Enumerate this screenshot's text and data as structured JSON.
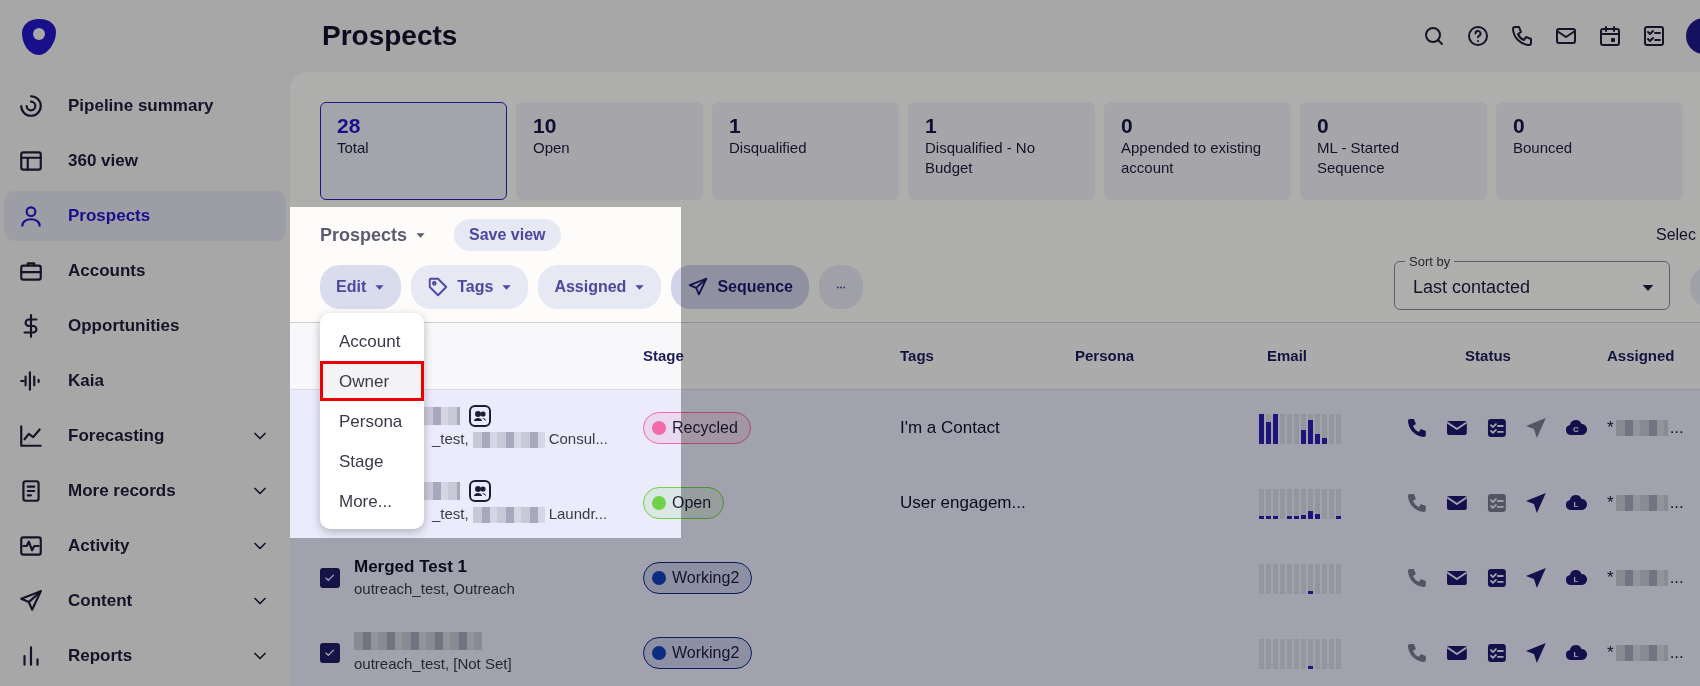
{
  "sidebar": {
    "items": [
      {
        "label": "Pipeline summary",
        "selected": false,
        "expandable": false
      },
      {
        "label": "360 view",
        "selected": false,
        "expandable": false
      },
      {
        "label": "Prospects",
        "selected": true,
        "expandable": false
      },
      {
        "label": "Accounts",
        "selected": false,
        "expandable": false
      },
      {
        "label": "Opportunities",
        "selected": false,
        "expandable": false
      },
      {
        "label": "Kaia",
        "selected": false,
        "expandable": false
      },
      {
        "label": "Forecasting",
        "selected": false,
        "expandable": true
      },
      {
        "label": "More records",
        "selected": false,
        "expandable": true
      },
      {
        "label": "Activity",
        "selected": false,
        "expandable": true
      },
      {
        "label": "Content",
        "selected": false,
        "expandable": true
      },
      {
        "label": "Reports",
        "selected": false,
        "expandable": true
      }
    ]
  },
  "header": {
    "title": "Prospects"
  },
  "stats": [
    {
      "value": "28",
      "label": "Total",
      "selected": true
    },
    {
      "value": "10",
      "label": "Open",
      "selected": false
    },
    {
      "value": "1",
      "label": "Disqualified",
      "selected": false
    },
    {
      "value": "1",
      "label": "Disqualified - No Budget",
      "selected": false
    },
    {
      "value": "0",
      "label": "Appended to existing account",
      "selected": false
    },
    {
      "value": "0",
      "label": "ML - Started Sequence",
      "selected": false
    },
    {
      "value": "0",
      "label": "Bounced",
      "selected": false
    }
  ],
  "view": {
    "title": "Prospects",
    "save_button": "Save view",
    "select_label": "Selec"
  },
  "toolbar": [
    {
      "kind": "dropdown",
      "label": "Edit",
      "open": true
    },
    {
      "kind": "tag",
      "label": "Tags",
      "open": false
    },
    {
      "kind": "dropdown",
      "label": "Assigned",
      "open": false
    },
    {
      "kind": "primary",
      "label": "Sequence",
      "open": false
    },
    {
      "kind": "more",
      "open": false
    }
  ],
  "edit_menu": [
    {
      "label": "Account",
      "highlighted": false
    },
    {
      "label": "Owner",
      "highlighted": true
    },
    {
      "label": "Persona",
      "highlighted": false
    },
    {
      "label": "Stage",
      "highlighted": false
    },
    {
      "label": "More...",
      "highlighted": false
    }
  ],
  "sort": {
    "label": "Sort by",
    "value": "Last contacted"
  },
  "table": {
    "columns": [
      "Stage",
      "Tags",
      "Persona",
      "Email",
      "Status",
      "Assigned"
    ],
    "rows": [
      {
        "name_redacted": true,
        "persona_badge": true,
        "subtitle": [
          {
            "kind": "text",
            "text": "_test,"
          },
          {
            "kind": "redacted"
          },
          {
            "kind": "text",
            "text": "Consul..."
          }
        ],
        "stage": {
          "label": "Recycled",
          "color": "#f06ba8"
        },
        "tags": "I'm a Contact",
        "status": [
          {
            "active": true
          },
          {
            "active": true
          },
          {
            "active": true
          },
          {
            "active": false
          },
          {
            "active": true,
            "letter": "C"
          }
        ],
        "assigned": [
          {
            "kind": "text",
            "text": "*"
          },
          {
            "kind": "redacted"
          },
          {
            "kind": "text",
            "text": "..."
          }
        ]
      },
      {
        "name_redacted": true,
        "persona_badge": true,
        "subtitle": [
          {
            "kind": "text",
            "text": "_test,"
          },
          {
            "kind": "redacted"
          },
          {
            "kind": "text",
            "text": "Laundr..."
          }
        ],
        "stage": {
          "label": "Open",
          "color": "#72d04a"
        },
        "tags": "User engagem...",
        "status": [
          {
            "active": false
          },
          {
            "active": true
          },
          {
            "active": false
          },
          {
            "active": true
          },
          {
            "active": true,
            "letter": "L"
          }
        ],
        "assigned": [
          {
            "kind": "text",
            "text": "*"
          },
          {
            "kind": "redacted"
          },
          {
            "kind": "text",
            "text": "..."
          }
        ]
      },
      {
        "checked": true,
        "name": "Merged Test 1",
        "name_redacted": false,
        "persona_badge": false,
        "subtitle": [
          {
            "kind": "text",
            "text": "outreach_test, Outreach"
          }
        ],
        "stage": {
          "label": "Working2",
          "color": "#0b2c80"
        },
        "status": [
          {
            "active": false
          },
          {
            "active": true
          },
          {
            "active": true
          },
          {
            "active": true
          },
          {
            "active": true,
            "letter": "L"
          }
        ],
        "assigned": [
          {
            "kind": "text",
            "text": "*"
          },
          {
            "kind": "redacted"
          },
          {
            "kind": "text",
            "text": "..."
          }
        ]
      },
      {
        "checked": true,
        "name_redacted": true,
        "persona_badge": false,
        "subtitle": [
          {
            "kind": "text",
            "text": "outreach_test, [Not Set]"
          }
        ],
        "stage": {
          "label": "Working2",
          "color": "#0b2c80"
        },
        "status": [
          {
            "active": false
          },
          {
            "active": true
          },
          {
            "active": true
          },
          {
            "active": true
          },
          {
            "active": true,
            "letter": "L"
          }
        ],
        "assigned": [
          {
            "kind": "text",
            "text": "*"
          },
          {
            "kind": "redacted"
          },
          {
            "kind": "text",
            "text": "..."
          }
        ]
      }
    ]
  },
  "guide_overlay": {
    "shown": true
  }
}
